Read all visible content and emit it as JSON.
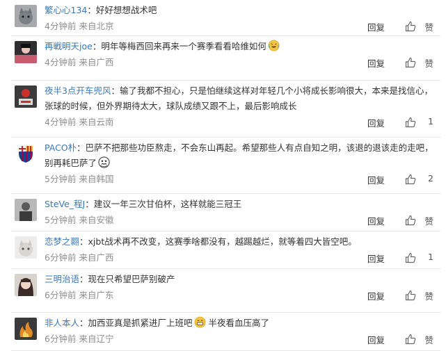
{
  "comments": [
    {
      "user": "繁心心134",
      "colon": "：",
      "text": "好好想想战术吧",
      "time": "4分钟前",
      "from": "来自北京",
      "reply": "回复",
      "likes": "赞",
      "emoji": null,
      "text_after": ""
    },
    {
      "user": "再戦明天joe",
      "colon": "：",
      "text": "明年等梅西回来再来一个赛季看看哈维如何",
      "time": "4分钟前",
      "from": "来自广西",
      "reply": "回复",
      "likes": "赞",
      "emoji": "laughing-crying-emoji",
      "text_after": ""
    },
    {
      "user": "夜半3点开车兜风",
      "colon": "：",
      "text": "输了我都不担心，只是怕继续这样对年轻几个小将成长影响很大，本来是找信心，张球的时候，但外界期待太大，球队成绩又跟不上，最后影响成长",
      "time": "4分钟前",
      "from": "来自云南",
      "reply": "回复",
      "likes": "1",
      "emoji": null,
      "text_after": ""
    },
    {
      "user": "PACO朴",
      "colon": "：",
      "text": "巴萨不把那些功臣熬走，不会东山再起。希望那些人有点自知之明，该退的退该走的走吧，别再耗巴萨了",
      "time": "5分钟前",
      "from": "来自韩国",
      "reply": "回复",
      "likes": "2",
      "emoji": "scared-emoji",
      "text_after": ""
    },
    {
      "user": "SteVe_程J",
      "colon": "：",
      "text": "建议一年三次甘伯杯，这样就能三冠王",
      "time": "5分钟前",
      "from": "来自安徽",
      "reply": "回复",
      "likes": "赞",
      "emoji": null,
      "text_after": ""
    },
    {
      "user": "恋梦之翾",
      "colon": "：",
      "text": "xjbt战术再不改变，这赛季啥都没有，越踢越烂，就等着四大皆空吧。",
      "time": "6分钟前",
      "from": "来自广西",
      "reply": "回复",
      "likes": "1",
      "emoji": null,
      "text_after": ""
    },
    {
      "user": "三明治语",
      "colon": "：",
      "text": "现在只希望巴萨别破产",
      "time": "6分钟前",
      "from": "来自广东",
      "reply": "回复",
      "likes": "赞",
      "emoji": null,
      "text_after": ""
    },
    {
      "user": "非人本人",
      "colon": "：",
      "text": "加西亚真是抓紧进厂上班吧",
      "time": "6分钟前",
      "from": "来自辽宁",
      "reply": "回复",
      "likes": "赞",
      "emoji": "grin-emoji",
      "text_after": " 半夜看血压高了"
    }
  ],
  "colors": {
    "username": "#3a78b8",
    "text": "#333333",
    "meta": "#8f8f8f",
    "divider": "#e6e6e6"
  }
}
